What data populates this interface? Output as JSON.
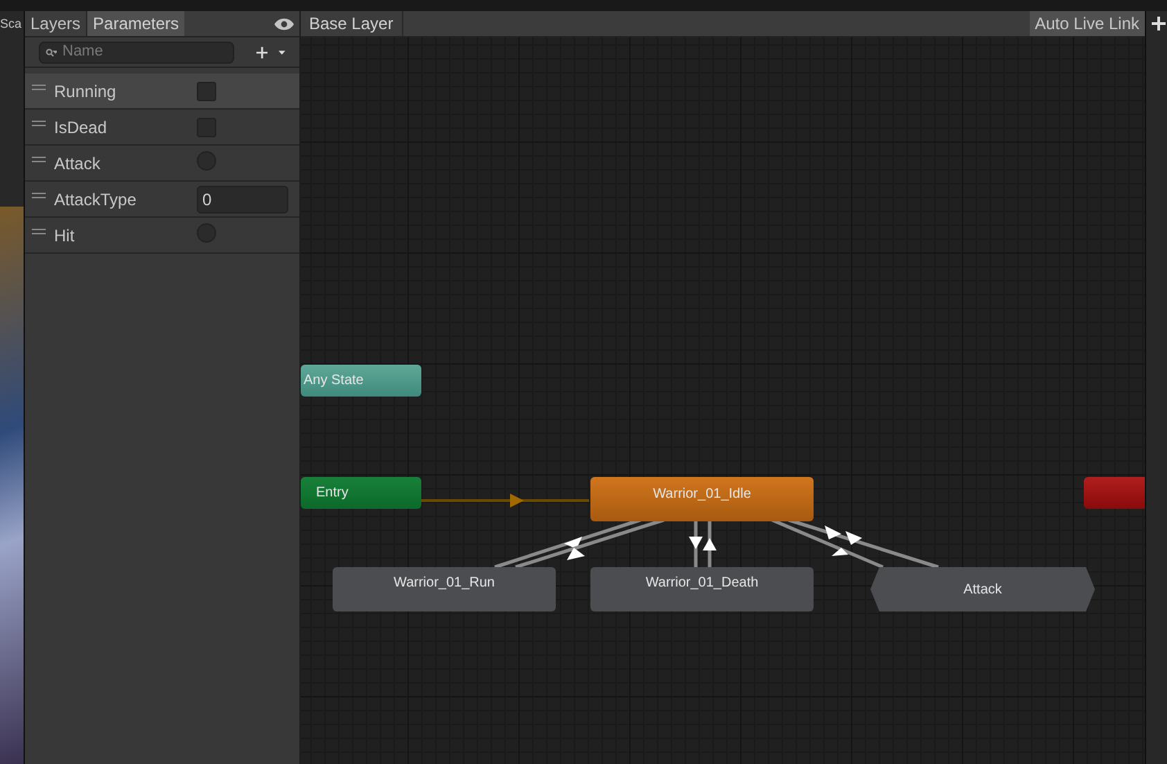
{
  "left_strip": {
    "label": "Sca"
  },
  "panel": {
    "tabs": [
      {
        "label": "Layers",
        "selected": false
      },
      {
        "label": "Parameters",
        "selected": true
      }
    ],
    "search": {
      "placeholder": "Name"
    },
    "parameters": [
      {
        "name": "Running",
        "kind": "bool",
        "checked": false,
        "selected": true
      },
      {
        "name": "IsDead",
        "kind": "bool",
        "checked": false,
        "selected": false
      },
      {
        "name": "Attack",
        "kind": "trigger",
        "selected": false
      },
      {
        "name": "AttackType",
        "kind": "int",
        "value": "0",
        "selected": false
      },
      {
        "name": "Hit",
        "kind": "trigger",
        "selected": false
      }
    ]
  },
  "breadcrumb": "Base Layer",
  "auto_live_link": "Auto Live Link",
  "graph": {
    "states": [
      {
        "label": "Any State",
        "kind": "any"
      },
      {
        "label": "Entry",
        "kind": "entry"
      },
      {
        "label": "Warrior_01_Idle",
        "kind": "default"
      },
      {
        "label": "Warrior_01_Run",
        "kind": "state"
      },
      {
        "label": "Warrior_01_Death",
        "kind": "state"
      },
      {
        "label": "Attack",
        "kind": "substate"
      },
      {
        "kind": "exit"
      }
    ]
  }
}
